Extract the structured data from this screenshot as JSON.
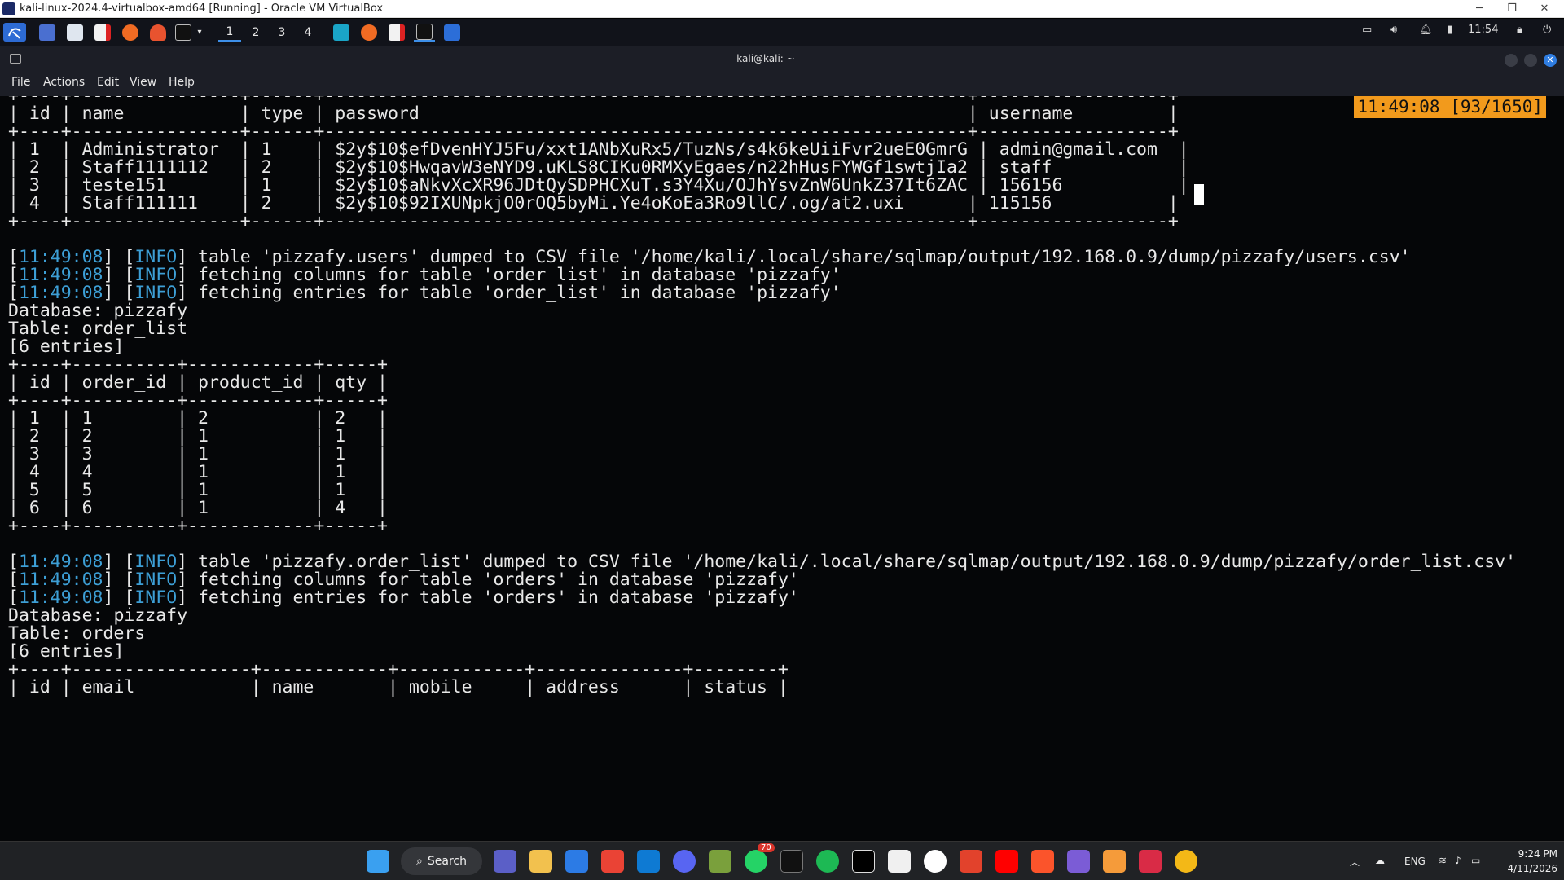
{
  "host_window": {
    "title": "kali-linux-2024.4-virtualbox-amd64 [Running] - Oracle VM VirtualBox",
    "minimize": "─",
    "restore": "❐",
    "close": "✕"
  },
  "kali_panel": {
    "workspaces": [
      "1",
      "2",
      "3",
      "4"
    ],
    "time": "11:54"
  },
  "terminal": {
    "title": "kali@kali: ~",
    "menu": [
      "File",
      "Actions",
      "Edit",
      "View",
      "Help"
    ],
    "status_clock": "11:49:08 [93/1650]",
    "lines": [
      "+----+----------------+------+-------------------------------------------------------------+------------------+",
      "| id | name           | type | password                                                    | username         |",
      "+----+----------------+------+-------------------------------------------------------------+------------------+",
      "| 1  | Administrator  | 1    | $2y$10$efDvenHYJ5Fu/xxt1ANbXuRx5/TuzNs/s4k6keUiiFvr2ueE0GmrG | admin@gmail.com  |",
      "| 2  | Staff1111112   | 2    | $2y$10$HwqavW3eNYD9.uKLS8CIKu0RMXyEgaes/n22hHusFYWGf1swtjIa2 | staff            |",
      "| 3  | teste151       | 1    | $2y$10$aNkvXcXR96JDtQySDPHCXuT.s3Y4Xu/OJhYsvZnW6UnkZ37It6ZAC | 156156           |",
      "| 4  | Staff111111    | 2    | $2y$10$92IXUNpkjO0rOQ5byMi.Ye4oKoEa3Ro9llC/.og/at2.uxi      | 115156           |",
      "+----+----------------+------+-------------------------------------------------------------+------------------+",
      "",
      "[11:49:08] [INFO] table 'pizzafy.users' dumped to CSV file '/home/kali/.local/share/sqlmap/output/192.168.0.9/dump/pizzafy/users.csv'",
      "[11:49:08] [INFO] fetching columns for table 'order_list' in database 'pizzafy'",
      "[11:49:08] [INFO] fetching entries for table 'order_list' in database 'pizzafy'",
      "Database: pizzafy",
      "Table: order_list",
      "[6 entries]",
      "+----+----------+------------+-----+",
      "| id | order_id | product_id | qty |",
      "+----+----------+------------+-----+",
      "| 1  | 1        | 2          | 2   |",
      "| 2  | 2        | 1          | 1   |",
      "| 3  | 3        | 1          | 1   |",
      "| 4  | 4        | 1          | 1   |",
      "| 5  | 5        | 1          | 1   |",
      "| 6  | 6        | 1          | 4   |",
      "+----+----------+------------+-----+",
      "",
      "[11:49:08] [INFO] table 'pizzafy.order_list' dumped to CSV file '/home/kali/.local/share/sqlmap/output/192.168.0.9/dump/pizzafy/order_list.csv'",
      "[11:49:08] [INFO] fetching columns for table 'orders' in database 'pizzafy'",
      "[11:49:08] [INFO] fetching entries for table 'orders' in database 'pizzafy'",
      "Database: pizzafy",
      "Table: orders",
      "[6 entries]",
      "+----+-----------------+------------+------------+--------------+--------+",
      "| id | email           | name       | mobile     | address      | status |"
    ]
  },
  "taskbar": {
    "search_label": "Search",
    "whatsapp_badge": "70",
    "lang": "ENG",
    "time": "9:24 PM",
    "date": "4/11/2026"
  },
  "colors": {
    "timestamp": "#3d9fd6",
    "clock_bg": "#f29a1c",
    "terminal_bg": "#050608"
  }
}
